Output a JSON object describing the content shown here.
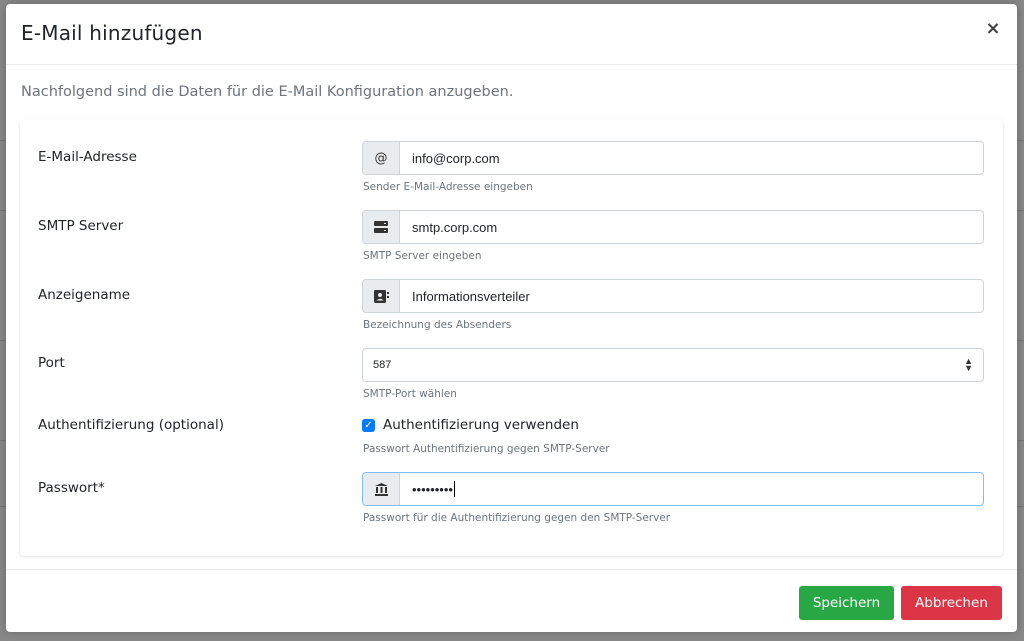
{
  "dialog": {
    "title": "E-Mail hinzufügen",
    "close_icon": "×",
    "intro": "Nachfolgend sind die Daten für die E-Mail Konfiguration anzugeben."
  },
  "form": {
    "email": {
      "label": "E-Mail-Adresse",
      "icon": "at-icon",
      "icon_glyph": "@",
      "value": "info@corp.com",
      "help": "Sender E-Mail-Adresse eingeben"
    },
    "smtp": {
      "label": "SMTP Server",
      "icon": "server-icon",
      "value": "smtp.corp.com",
      "help": "SMTP Server eingeben"
    },
    "display_name": {
      "label": "Anzeigename",
      "icon": "address-card-icon",
      "value": "Informationsverteiler",
      "help": "Bezeichnung des Absenders"
    },
    "port": {
      "label": "Port",
      "selected": "587",
      "help": "SMTP-Port wählen"
    },
    "auth": {
      "label": "Authentifizierung (optional)",
      "checkbox_label": "Authentifizierung verwenden",
      "checked": true,
      "help": "Passwort Authentifizierung gegen SMTP-Server"
    },
    "password": {
      "label": "Passwort*",
      "icon": "bank-icon",
      "value": "•••••••••",
      "help": "Passwort für die Authentifizierung gegen den SMTP-Server"
    }
  },
  "footer": {
    "save_label": "Speichern",
    "cancel_label": "Abbrechen"
  },
  "colors": {
    "save": "#28a745",
    "cancel": "#dc3545",
    "checkbox": "#007bff"
  }
}
